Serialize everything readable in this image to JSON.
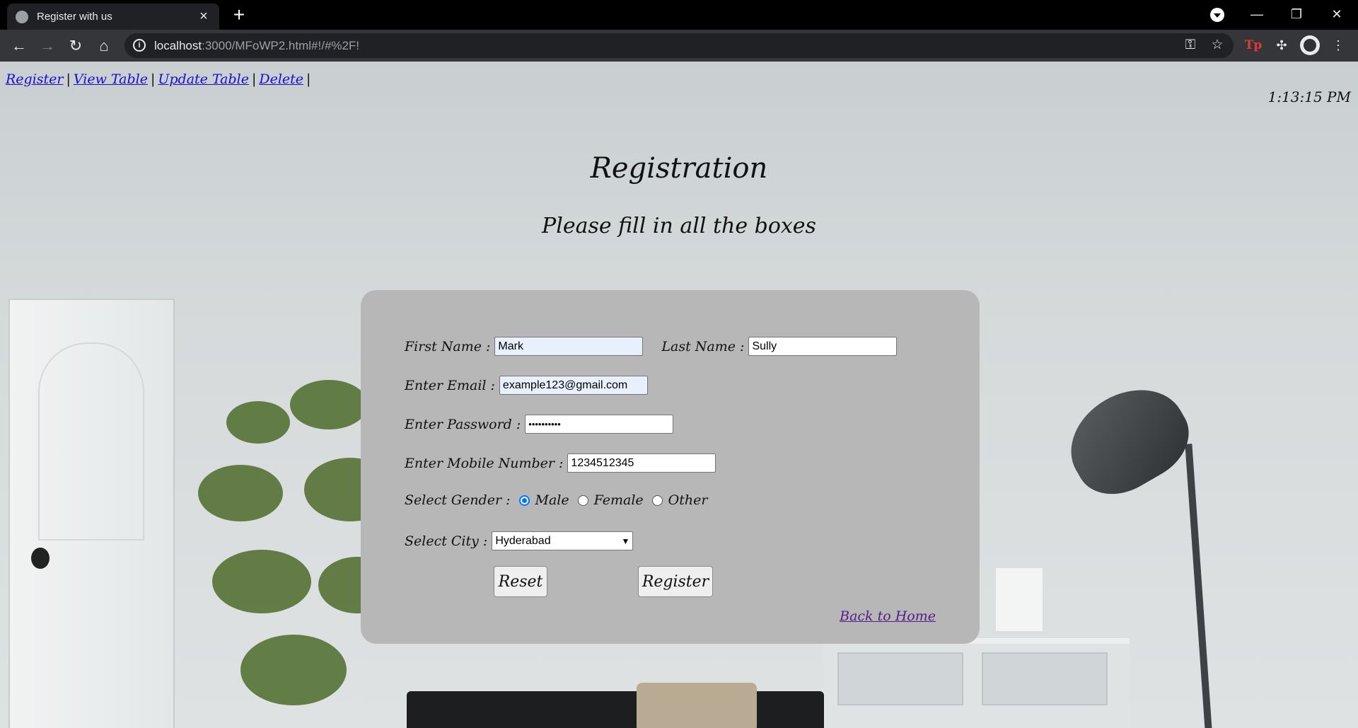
{
  "browser": {
    "tab_title": "Register with us",
    "url_host": "localhost",
    "url_rest": ":3000/MFoWP2.html#!/#%2F!"
  },
  "nav": {
    "links": [
      "Register",
      "View Table",
      "Update Table",
      "Delete"
    ],
    "separator": "|"
  },
  "clock": "1:13:15 PM",
  "heading": {
    "title": "Registration",
    "subtitle": "Please fill in all the boxes"
  },
  "form": {
    "first_name_label": "First Name :",
    "first_name_value": "Mark",
    "last_name_label": "Last Name :",
    "last_name_value": "Sully",
    "email_label": "Enter Email :",
    "email_value": "example123@gmail.com",
    "password_label": "Enter Password :",
    "password_value": "••••••••••",
    "mobile_label": "Enter Mobile Number :",
    "mobile_value": "1234512345",
    "gender_label": "Select Gender :",
    "gender_options": [
      "Male",
      "Female",
      "Other"
    ],
    "gender_selected": "Male",
    "city_label": "Select City :",
    "city_value": "Hyderabad",
    "reset_label": "Reset",
    "register_label": "Register",
    "back_link": "Back to Home"
  },
  "colors": {
    "card": "#b7b7b7",
    "link": "#1a0dcc",
    "visited_link": "#551a8b",
    "radio_accent": "#0075ff"
  }
}
